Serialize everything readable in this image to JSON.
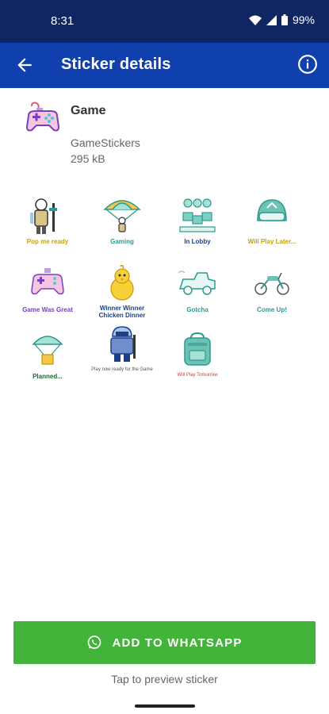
{
  "status": {
    "time": "8:31",
    "battery": "99%"
  },
  "appbar": {
    "title": "Sticker details"
  },
  "pack": {
    "name": "Game",
    "publisher": "GameStickers",
    "size": "295 kB"
  },
  "stickers": [
    {
      "caption": "Pop me ready",
      "color": "#c8a400",
      "icon": "soldier-icon"
    },
    {
      "caption": "Gaming",
      "color": "#2a9a8f",
      "icon": "parachute-icon"
    },
    {
      "caption": "In Lobby",
      "color": "#1d3f8a",
      "icon": "squad-icon"
    },
    {
      "caption": "Will Play Later...",
      "color": "#c8a400",
      "icon": "helmet-icon"
    },
    {
      "caption": "Game Was Great",
      "color": "#7a3fc0",
      "icon": "gamepad-icon"
    },
    {
      "caption": "Winner Winner Chicken Dinner",
      "color": "#1d3f8a",
      "icon": "chicken-icon"
    },
    {
      "caption": "Gotcha",
      "color": "#2a9a8f",
      "icon": "jeep-icon"
    },
    {
      "caption": "Come Up!",
      "color": "#2a9a8f",
      "icon": "motorbike-icon"
    },
    {
      "caption": "Planned...",
      "color": "#1a6a30",
      "icon": "airdrop-icon"
    },
    {
      "caption": "Play now ready for the Game",
      "color": "#555555",
      "icon": "player-icon"
    },
    {
      "caption": "Will Play Tomorrow",
      "color": "#d63a3a",
      "icon": "backpack-icon"
    }
  ],
  "actions": {
    "add_label": "ADD TO WHATSAPP",
    "hint": "Tap to preview sticker"
  }
}
